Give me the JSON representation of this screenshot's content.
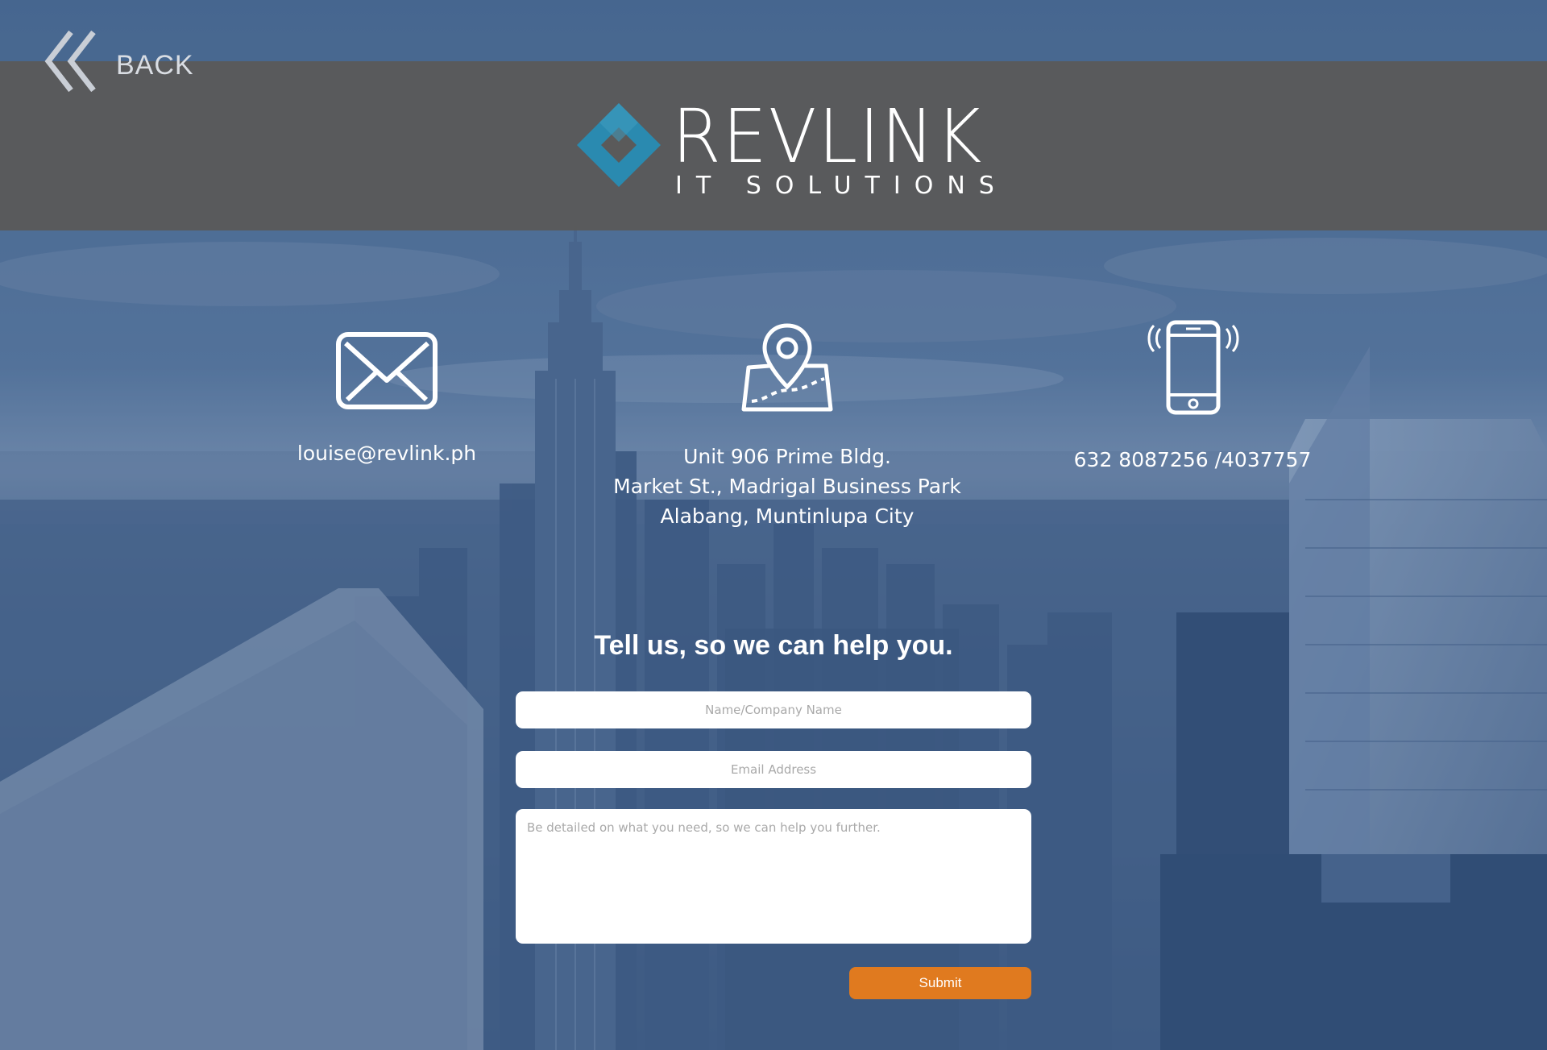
{
  "nav": {
    "back_label": "BACK"
  },
  "brand": {
    "name": "REVLINK",
    "tagline": "IT SOLUTIONS",
    "logo_color": "#2a8ab0"
  },
  "contacts": {
    "email": {
      "icon": "envelope-icon",
      "text": "louise@revlink.ph"
    },
    "address": {
      "icon": "map-pin-icon",
      "lines": [
        "Unit 906 Prime Bldg.",
        "Market St., Madrigal Business Park",
        "Alabang, Muntinlupa City"
      ]
    },
    "phone": {
      "icon": "mobile-phone-icon",
      "text": "632 8087256 /4037757"
    }
  },
  "form": {
    "heading": "Tell us, so we can help you.",
    "name_placeholder": "Name/Company Name",
    "email_placeholder": "Email Address",
    "message_placeholder": "Be detailed on what you need, so we can help you further.",
    "submit_label": "Submit",
    "submit_color": "#e07a1f"
  },
  "theme": {
    "overlay_color": "#3b5a85",
    "header_color": "#5a5a5a"
  }
}
